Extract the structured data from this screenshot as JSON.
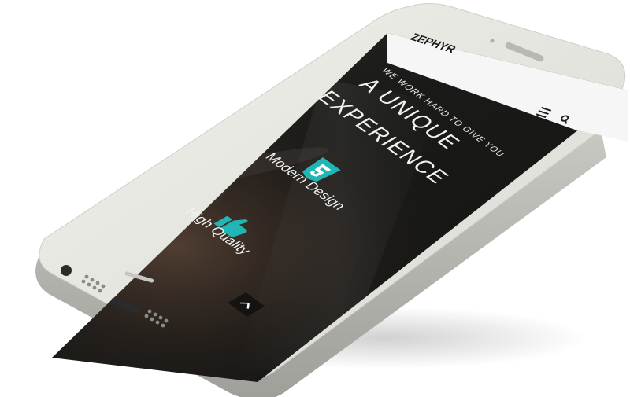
{
  "app": {
    "brand": "ZEPHYR"
  },
  "header": {
    "menu_icon": "hamburger-menu-icon",
    "search_icon": "search-icon"
  },
  "hero": {
    "tagline": "WE WORK HARD TO GIVE YOU",
    "title_line1": "A UNIQUE",
    "title_line2": "EXPERIENCE"
  },
  "features": [
    {
      "label": "Modern Design",
      "icon": "html5-icon"
    },
    {
      "label": "High Quality",
      "icon": "thumbs-up-icon"
    }
  ],
  "scroll_top": {
    "icon": "chevron-up-icon"
  },
  "colors": {
    "accent": "#22b5b5",
    "screen_dark": "#1c1c1c",
    "header_bg": "#f6f6f6",
    "device_body": "#e6e6e1"
  }
}
